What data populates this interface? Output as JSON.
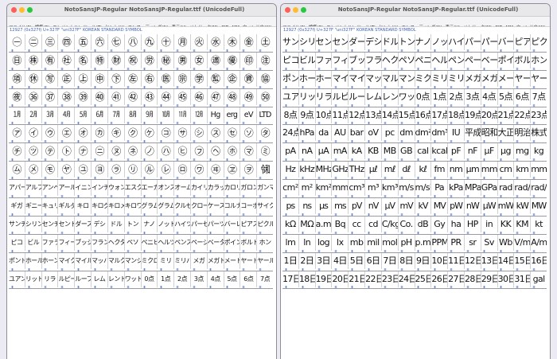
{
  "windows": [
    {
      "title": "NotoSansJP-Regular  NotoSansJP-Regular.ttf (UnicodeFull)",
      "menu": [
        "ファイル(F)",
        "編集(E)",
        "エレメント(L)",
        "ツール(T)",
        "ヒント(H)",
        "エンコーディング(N)",
        "表示(V)",
        "メトリック(M)",
        "CID",
        "MM",
        "ウィンドウ(W)",
        "ヘルプ(H)"
      ],
      "info": "12927 (0x327f) U+327F \"uni327F\" KOREAN STANDARD SYMBOL",
      "rows": [
        [
          "㊀",
          "㊁",
          "㊂",
          "㊃",
          "㊄",
          "㊅",
          "㊆",
          "㊇",
          "㊈",
          "㊉",
          "㊊",
          "㊋",
          "㊌",
          "㊍",
          "㊎",
          "㊏"
        ],
        [
          "㊐",
          "㊑",
          "㊒",
          "㊓",
          "㊔",
          "㊕",
          "㊖",
          "㊗",
          "㊘",
          "㊙",
          "㊚",
          "㊛",
          "㊜",
          "㊝",
          "㊞",
          "㊟"
        ],
        [
          "㊠",
          "㊡",
          "㊢",
          "㊣",
          "㊤",
          "㊥",
          "㊦",
          "㊧",
          "㊨",
          "㊩",
          "㊪",
          "㊫",
          "㊬",
          "㊭",
          "㊮",
          "㊯"
        ],
        [
          "㊰",
          "㊱",
          "㊲",
          "㊳",
          "㊴",
          "㊵",
          "㊶",
          "㊷",
          "㊸",
          "㊹",
          "㊺",
          "㊻",
          "㊼",
          "㊽",
          "㊾",
          "㊿"
        ],
        [
          "㋀",
          "㋁",
          "㋂",
          "㋃",
          "㋄",
          "㋅",
          "㋆",
          "㋇",
          "㋈",
          "㋉",
          "㋊",
          "㋋",
          "Hg",
          "erg",
          "eV",
          "LTD"
        ],
        [
          "㋐",
          "㋑",
          "㋒",
          "㋓",
          "㋔",
          "㋕",
          "㋖",
          "㋗",
          "㋘",
          "㋙",
          "㋚",
          "㋛",
          "㋜",
          "㋝",
          "㋞",
          "㋟"
        ],
        [
          "㋠",
          "㋡",
          "㋢",
          "㋣",
          "㋤",
          "㋥",
          "㋦",
          "㋧",
          "㋨",
          "㋩",
          "㋪",
          "㋫",
          "㋬",
          "㋭",
          "㋮",
          "㋯"
        ],
        [
          "㋰",
          "㋱",
          "㋲",
          "㋳",
          "㋴",
          "㋵",
          "㋶",
          "㋷",
          "㋸",
          "㋹",
          "㋺",
          "㋻",
          "㋼",
          "㋽",
          "㋾",
          "㋿"
        ],
        [
          "アパート",
          "アルファ",
          "アンペア",
          "アール",
          "イニング",
          "インチ",
          "ウォン",
          "エスクード",
          "エーカー",
          "オンス",
          "オーム",
          "カイリ",
          "カラット",
          "カロリー",
          "ガロン",
          "ガンマ"
        ],
        [
          "ギガ",
          "ギニー",
          "キュリー",
          "ギルダー",
          "キロ",
          "キログラム",
          "キロメートル",
          "キロワット",
          "グラム",
          "グラムトン",
          "クルゼイロ",
          "クローネ",
          "ケース",
          "コルナ",
          "コーポ",
          "サイクル"
        ],
        [
          "サンチーム",
          "シリング",
          "センチ",
          "セント",
          "ダース",
          "デシ",
          "ドル",
          "トン",
          "ナノ",
          "ノット",
          "ハイツ",
          "パーセント",
          "パーツ",
          "バーレル",
          "ピアストル",
          "ピクル"
        ],
        [
          "ピコ",
          "ビル",
          "ファラッド",
          "フィート",
          "ブッシェル",
          "フラン",
          "ヘクタール",
          "ペソ",
          "ペニヒ",
          "ヘルツ",
          "ペンス",
          "ページ",
          "ベータ",
          "ポイント",
          "ボルト",
          "ホン"
        ],
        [
          "ポンド",
          "ホール",
          "ホーン",
          "マイクロ",
          "マイル",
          "マッハ",
          "マルク",
          "マンション",
          "ミクロン",
          "ミリ",
          "ミリバール",
          "メガ",
          "メガトン",
          "メートル",
          "ヤード",
          "ヤール"
        ],
        [
          "ユアン",
          "リットル",
          "リラ",
          "ルピー",
          "ルーブル",
          "レム",
          "レントゲン",
          "ワット",
          "0点",
          "1点",
          "2点",
          "3点",
          "4点",
          "5点",
          "6点",
          "7点"
        ]
      ]
    },
    {
      "title": "NotoSansJP-Regular  NotoSansJP-Regular.ttf (UnicodeFull)",
      "menu": [
        "ファイル(F)",
        "編集(E)",
        "エレメント(L)",
        "ツール(T)",
        "ヒント(H)",
        "エンコーディング(N)",
        "表示(V)",
        "メトリック(M)",
        "CID",
        "MM",
        "ウィンドウ(W)",
        "ヘルプ(H)"
      ],
      "info": "12927 (0x327f) U+327F \"uni327F\" KOREAN STANDARD SYMBOL",
      "rows": [
        [
          "サンチーム",
          "シリング",
          "センチ",
          "セント",
          "ダース",
          "デシ",
          "ドル",
          "トン",
          "ナノ",
          "ノット",
          "ハイツ",
          "パーセント",
          "パーツ",
          "バーレル",
          "ピアストル",
          "ピクル"
        ],
        [
          "ピコ",
          "ビル",
          "ファラッド",
          "フィート",
          "ブッシェル",
          "フラン",
          "ヘクタール",
          "ペソ",
          "ペニヒ",
          "ヘルツ",
          "ペンス",
          "ページ",
          "ベータ",
          "ポイント",
          "ボルト",
          "ホン"
        ],
        [
          "ポンド",
          "ホール",
          "ホーン",
          "マイクロ",
          "マイル",
          "マッハ",
          "マルク",
          "マンション",
          "ミクロン",
          "ミリ",
          "ミリバール",
          "メガ",
          "メガトン",
          "メートル",
          "ヤード",
          "ヤール"
        ],
        [
          "ユアン",
          "リットル",
          "リラ",
          "ルピー",
          "ルーブル",
          "レム",
          "レントゲン",
          "ワット",
          "0点",
          "1点",
          "2点",
          "3点",
          "4点",
          "5点",
          "6点",
          "7点"
        ],
        [
          "8点",
          "9点",
          "10点",
          "11点",
          "12点",
          "13点",
          "14点",
          "15点",
          "16点",
          "17点",
          "18点",
          "19点",
          "20点",
          "21点",
          "22点",
          "23点"
        ],
        [
          "24点",
          "hPa",
          "da",
          "AU",
          "bar",
          "oV",
          "pc",
          "dm",
          "dm²",
          "dm³",
          "IU",
          "平成",
          "昭和",
          "大正",
          "明治",
          "株式会社"
        ],
        [
          "pA",
          "nA",
          "μA",
          "mA",
          "kA",
          "KB",
          "MB",
          "GB",
          "cal",
          "kcal",
          "pF",
          "nF",
          "μF",
          "μg",
          "mg",
          "kg"
        ],
        [
          "Hz",
          "kHz",
          "MHz",
          "GHz",
          "THz",
          "μℓ",
          "mℓ",
          "dℓ",
          "kℓ",
          "fm",
          "nm",
          "μm",
          "mm",
          "cm",
          "km",
          "mm²"
        ],
        [
          "cm²",
          "m²",
          "km²",
          "mm³",
          "cm³",
          "m³",
          "km³",
          "m/s",
          "m/s²",
          "Pa",
          "kPa",
          "MPa",
          "GPa",
          "rad",
          "rad/s",
          "rad/s²"
        ],
        [
          "ps",
          "ns",
          "μs",
          "ms",
          "pV",
          "nV",
          "μV",
          "mV",
          "kV",
          "MV",
          "pW",
          "nW",
          "μW",
          "mW",
          "kW",
          "MW"
        ],
        [
          "kΩ",
          "MΩ",
          "a.m.",
          "Bq",
          "cc",
          "cd",
          "C/kg",
          "Co.",
          "dB",
          "Gy",
          "ha",
          "HP",
          "in",
          "KK",
          "KM",
          "kt"
        ],
        [
          "lm",
          "ln",
          "log",
          "lx",
          "mb",
          "mil",
          "mol",
          "pH",
          "p.m.",
          "PPM",
          "PR",
          "sr",
          "Sv",
          "Wb",
          "V/m",
          "A/m"
        ],
        [
          "1日",
          "2日",
          "3日",
          "4日",
          "5日",
          "6日",
          "7日",
          "8日",
          "9日",
          "10日",
          "11日",
          "12日",
          "13日",
          "14日",
          "15日",
          "16日"
        ],
        [
          "17日",
          "18日",
          "19日",
          "20日",
          "21日",
          "22日",
          "23日",
          "24日",
          "25日",
          "26日",
          "27日",
          "28日",
          "29日",
          "30日",
          "31日",
          "gal"
        ]
      ]
    }
  ]
}
